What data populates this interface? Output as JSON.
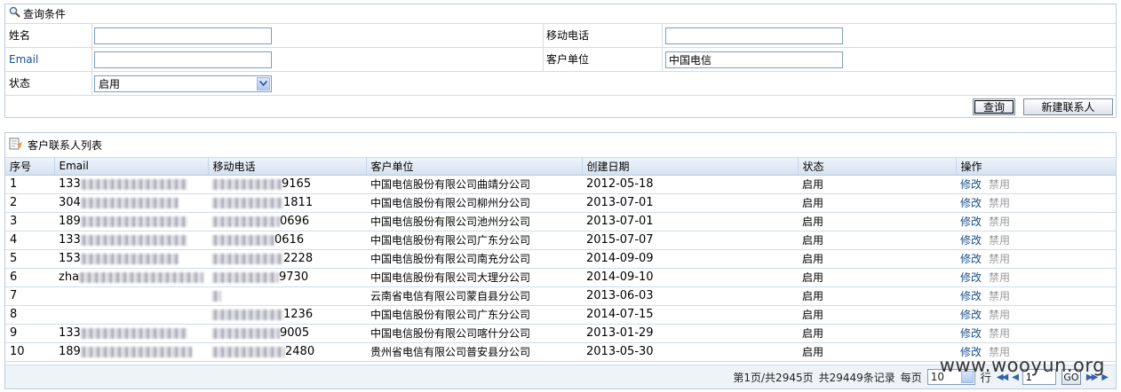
{
  "query": {
    "title": "查询条件",
    "name_label": "姓名",
    "name_value": "",
    "mobile_label": "移动电话",
    "mobile_value": "",
    "email_label": "Email",
    "email_value": "",
    "company_label": "客户单位",
    "company_value": "中国电信",
    "status_label": "状态",
    "status_value": "启用",
    "query_button": "查询",
    "new_contact_button": "新建联系人"
  },
  "list": {
    "title": "客户联系人列表",
    "columns": [
      "序号",
      "Email",
      "移动电话",
      "客户单位",
      "创建日期",
      "状态",
      "操作"
    ],
    "rows": [
      {
        "no": "1",
        "email": "133",
        "mobile": "9165",
        "company": "中国电信股份有限公司曲靖分公司",
        "date": "2012-05-18",
        "status": "启用"
      },
      {
        "no": "2",
        "email": "304",
        "mobile": "1811",
        "company": "中国电信股份有限公司柳州分公司",
        "date": "2013-07-01",
        "status": "启用"
      },
      {
        "no": "3",
        "email": "189",
        "mobile": "0696",
        "company": "中国电信股份有限公司池州分公司",
        "date": "2013-07-01",
        "status": "启用"
      },
      {
        "no": "4",
        "email": "133",
        "mobile": "0616",
        "company": "中国电信股份有限公司广东分公司",
        "date": "2015-07-07",
        "status": "启用"
      },
      {
        "no": "5",
        "email": "153",
        "mobile": "2228",
        "company": "中国电信股份有限公司南充分公司",
        "date": "2014-09-09",
        "status": "启用"
      },
      {
        "no": "6",
        "email": "zha",
        "mobile": "9730",
        "company": "中国电信股份有限公司大理分公司",
        "date": "2014-09-10",
        "status": "启用"
      },
      {
        "no": "7",
        "email": "",
        "mobile": "",
        "company": "云南省电信有限公司蒙自县分公司",
        "date": "2013-06-03",
        "status": "启用"
      },
      {
        "no": "8",
        "email": "",
        "mobile": "1236",
        "company": "中国电信股份有限公司广东分公司",
        "date": "2014-07-15",
        "status": "启用"
      },
      {
        "no": "9",
        "email": "133",
        "mobile": "9005",
        "company": "中国电信股份有限公司喀什分公司",
        "date": "2013-01-29",
        "status": "启用"
      },
      {
        "no": "10",
        "email": "189",
        "mobile": "2480",
        "company": "贵州省电信有限公司普安县分公司",
        "date": "2013-05-30",
        "status": "启用"
      }
    ],
    "edit_label": "修改",
    "disable_label": "禁用"
  },
  "pager": {
    "page_info": "第1页/共2945页",
    "total_info": "共29449条记录",
    "per_page_label": "每页",
    "per_page_value": "10",
    "rows_label": "行",
    "page_input": "1",
    "go_label": "GO"
  },
  "watermark": "www.wooyun.org"
}
